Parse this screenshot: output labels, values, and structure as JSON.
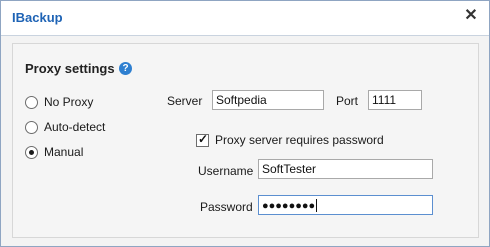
{
  "window": {
    "title": "IBackup"
  },
  "section": {
    "title": "Proxy settings"
  },
  "proxy_modes": [
    {
      "label": "No Proxy",
      "selected": false
    },
    {
      "label": "Auto-detect",
      "selected": false
    },
    {
      "label": "Manual",
      "selected": true
    }
  ],
  "server": {
    "label": "Server",
    "value": "Softpedia"
  },
  "port": {
    "label": "Port",
    "value": "1111"
  },
  "requires_password": {
    "label": "Proxy server requires password",
    "checked": true
  },
  "username": {
    "label": "Username",
    "value": "SoftTester"
  },
  "password": {
    "label": "Password",
    "masked": "●●●●●●●●"
  },
  "colors": {
    "title": "#1e63b5",
    "help": "#2e7fd0"
  }
}
